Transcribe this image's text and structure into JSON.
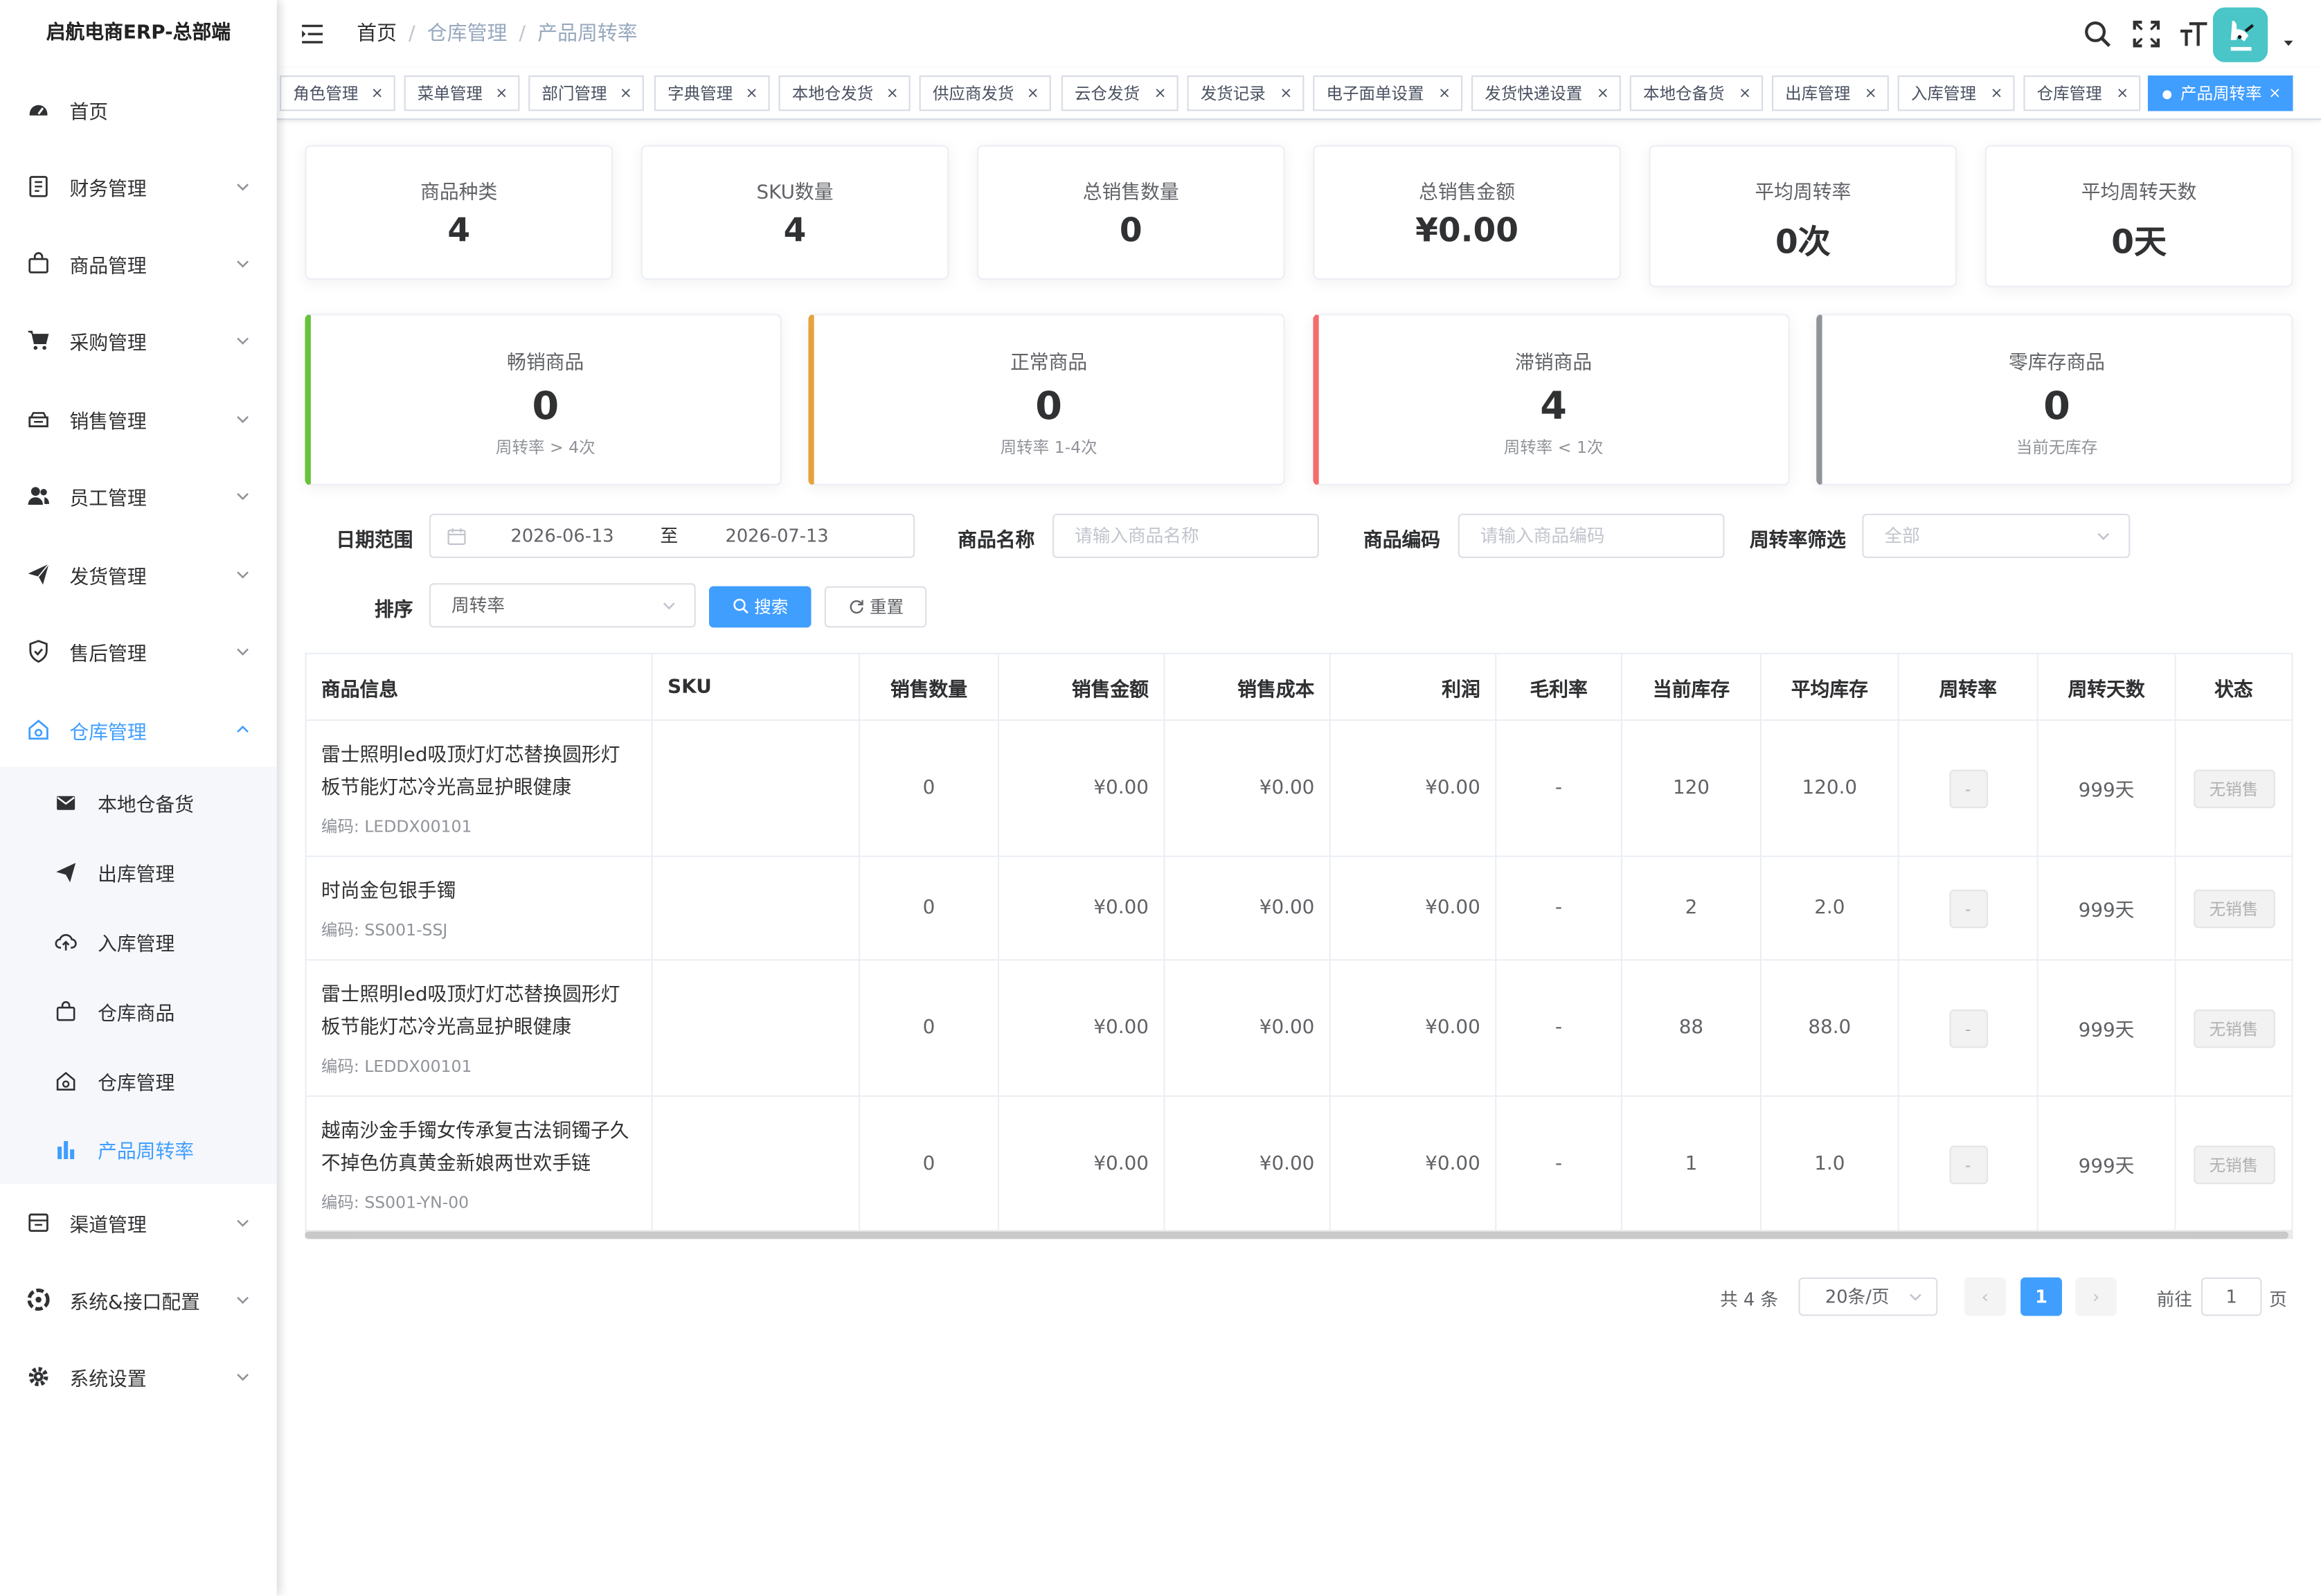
{
  "app": {
    "title": "启航电商ERP-总部端"
  },
  "sidebar": {
    "items": [
      {
        "label": "首页",
        "icon": "dashboard-icon"
      },
      {
        "label": "财务管理",
        "icon": "finance-icon"
      },
      {
        "label": "商品管理",
        "icon": "goods-icon"
      },
      {
        "label": "采购管理",
        "icon": "cart-icon"
      },
      {
        "label": "销售管理",
        "icon": "sales-icon"
      },
      {
        "label": "员工管理",
        "icon": "people-icon"
      },
      {
        "label": "发货管理",
        "icon": "send-icon"
      },
      {
        "label": "售后管理",
        "icon": "shield-icon"
      },
      {
        "label": "仓库管理",
        "icon": "warehouse-icon"
      },
      {
        "label": "渠道管理",
        "icon": "channel-icon"
      },
      {
        "label": "系统&接口配置",
        "icon": "system-icon"
      },
      {
        "label": "系统设置",
        "icon": "gear-icon"
      }
    ],
    "sub_items": [
      {
        "label": "本地仓备货",
        "icon": "mail-icon"
      },
      {
        "label": "出库管理",
        "icon": "send-icon"
      },
      {
        "label": "入库管理",
        "icon": "upload-cloud-icon"
      },
      {
        "label": "仓库商品",
        "icon": "goods-icon"
      },
      {
        "label": "仓库管理",
        "icon": "warehouse-icon"
      },
      {
        "label": "产品周转率",
        "icon": "bar-chart-icon"
      }
    ]
  },
  "header": {
    "breadcrumb": [
      "首页",
      "仓库管理",
      "产品周转率"
    ]
  },
  "tags": [
    "角色管理",
    "菜单管理",
    "部门管理",
    "字典管理",
    "本地仓发货",
    "供应商发货",
    "云仓发货",
    "发货记录",
    "电子面单设置",
    "发货快递设置",
    "本地仓备货",
    "出库管理",
    "入库管理",
    "仓库管理",
    "产品周转率"
  ],
  "stats": [
    {
      "label": "商品种类",
      "value": "4"
    },
    {
      "label": "SKU数量",
      "value": "4"
    },
    {
      "label": "总销售数量",
      "value": "0"
    },
    {
      "label": "总销售金额",
      "value": "¥0.00"
    },
    {
      "label": "平均周转率",
      "value": "0次"
    },
    {
      "label": "平均周转天数",
      "value": "0天"
    }
  ],
  "turnover_cards": [
    {
      "label": "畅销商品",
      "value": "0",
      "desc": "周转率 > 4次",
      "color": "#67c23a"
    },
    {
      "label": "正常商品",
      "value": "0",
      "desc": "周转率 1-4次",
      "color": "#e6a23c"
    },
    {
      "label": "滞销商品",
      "value": "4",
      "desc": "周转率 < 1次",
      "color": "#f56c6c"
    },
    {
      "label": "零库存商品",
      "value": "0",
      "desc": "当前无库存",
      "color": "#909399"
    }
  ],
  "filters": {
    "date_label": "日期范围",
    "date_start": "2026-06-13",
    "date_sep": "至",
    "date_end": "2026-07-13",
    "name_label": "商品名称",
    "name_placeholder": "请输入商品名称",
    "code_label": "商品编码",
    "code_placeholder": "请输入商品编码",
    "rate_label": "周转率筛选",
    "rate_value": "全部",
    "sort_label": "排序",
    "sort_value": "周转率",
    "search_label": "搜索",
    "reset_label": "重置"
  },
  "table": {
    "columns": [
      "商品信息",
      "SKU",
      "销售数量",
      "销售金额",
      "销售成本",
      "利润",
      "毛利率",
      "当前库存",
      "平均库存",
      "周转率",
      "周转天数",
      "状态"
    ],
    "rows": [
      {
        "name": "雷士照明led吸顶灯灯芯替换圆形灯板节能灯芯冷光高显护眼健康",
        "code": "编码: LEDDX00101",
        "sku": "",
        "qty": "0",
        "amount": "¥0.00",
        "cost": "¥0.00",
        "profit": "¥0.00",
        "margin": "-",
        "stock": "120",
        "avg_stock": "120.0",
        "rate": "-",
        "days": "999天",
        "status": "无销售"
      },
      {
        "name": "时尚金包银手镯",
        "code": "编码: SS001-SSJ",
        "sku": "",
        "qty": "0",
        "amount": "¥0.00",
        "cost": "¥0.00",
        "profit": "¥0.00",
        "margin": "-",
        "stock": "2",
        "avg_stock": "2.0",
        "rate": "-",
        "days": "999天",
        "status": "无销售"
      },
      {
        "name": "雷士照明led吸顶灯灯芯替换圆形灯板节能灯芯冷光高显护眼健康",
        "code": "编码: LEDDX00101",
        "sku": "",
        "qty": "0",
        "amount": "¥0.00",
        "cost": "¥0.00",
        "profit": "¥0.00",
        "margin": "-",
        "stock": "88",
        "avg_stock": "88.0",
        "rate": "-",
        "days": "999天",
        "status": "无销售"
      },
      {
        "name": "越南沙金手镯女传承复古法铜镯子久不掉色仿真黄金新娘两世欢手链",
        "code": "编码: SS001-YN-00",
        "sku": "",
        "qty": "0",
        "amount": "¥0.00",
        "cost": "¥0.00",
        "profit": "¥0.00",
        "margin": "-",
        "stock": "1",
        "avg_stock": "1.0",
        "rate": "-",
        "days": "999天",
        "status": "无销售"
      }
    ]
  },
  "pagination": {
    "total": "共 4 条",
    "page_size": "20条/页",
    "current": "1",
    "goto_label": "前往",
    "goto_value": "1",
    "page_unit": "页"
  },
  "colors": {
    "primary": "#409eff",
    "avatar_bg": "#4ac5c8"
  }
}
